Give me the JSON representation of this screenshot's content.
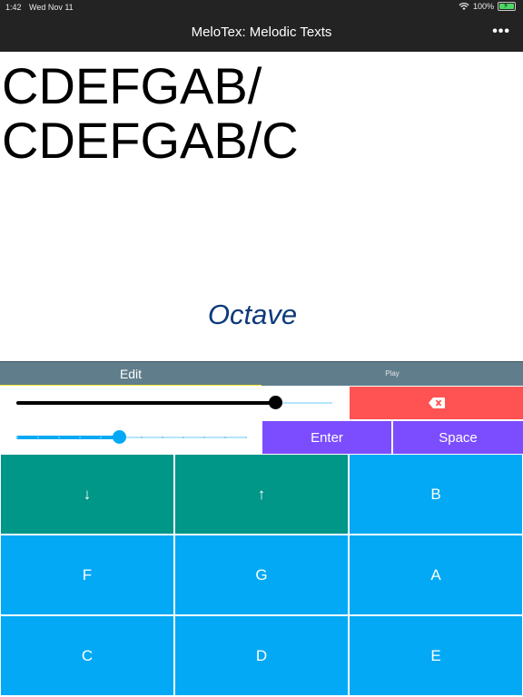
{
  "status_bar": {
    "time": "1:42",
    "date": "Wed Nov 11",
    "battery": "100%"
  },
  "nav": {
    "title": "MeloTex: Melodic Texts",
    "more_label": "•••"
  },
  "display": {
    "melody_text": "CDEFGAB/\nCDEFGAB/C",
    "caption": "Octave"
  },
  "tabs": [
    {
      "label": "Edit",
      "selected": true
    },
    {
      "label": "Play",
      "selected": false
    }
  ],
  "controls": {
    "slider_1_value": 0.82,
    "slider_2_value": 0.45,
    "backspace_icon": "backspace-icon",
    "enter_label": "Enter",
    "space_label": "Space"
  },
  "keypad": {
    "rows": [
      [
        {
          "label": "↓",
          "icon": "arrow-down-icon"
        },
        {
          "label": "↑",
          "icon": "arrow-up-icon"
        },
        {
          "label": "B"
        }
      ],
      [
        {
          "label": "F"
        },
        {
          "label": "G"
        },
        {
          "label": "A"
        }
      ],
      [
        {
          "label": "C"
        },
        {
          "label": "D"
        },
        {
          "label": "E"
        }
      ]
    ]
  },
  "colors": {
    "topbar": "#232323",
    "tab_bar": "#607d8b",
    "tab_indicator": "#ffeb3b",
    "backspace_button": "#ff5252",
    "action_buttons": "#7c4dff",
    "key_teal": "#009688",
    "key_blue": "#03a9f4",
    "caption": "#0d3a7a"
  }
}
